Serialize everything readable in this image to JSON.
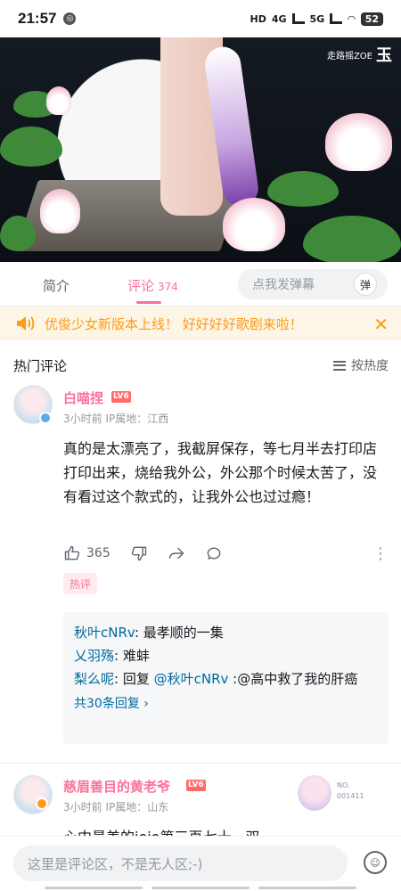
{
  "status_bar": {
    "time": "21:57",
    "network": "4G",
    "network2": "5G",
    "battery": "52"
  },
  "video": {
    "watermark_small": "走路摇ZOE",
    "watermark_logo": "玉"
  },
  "tabs": {
    "intro": "简介",
    "comments": "评论",
    "comment_count": "374"
  },
  "danmaku": {
    "placeholder": "点我发弹幕",
    "button": "弹"
  },
  "notice": {
    "text": "优俊少女新版本上线！ 好好好好歌剧来啦！",
    "close": "✕"
  },
  "hot": {
    "title": "热门评论",
    "sort_label": "按热度"
  },
  "comments": [
    {
      "username": "白喵捏",
      "level": "LV6",
      "meta": "3小时前  IP属地：江西",
      "text": "真的是太漂亮了，我截屏保存，等七月半去打印店打印出来，烧给我外公，外公那个时候太苦了，没有看过这个款式的，让我外公也过过瘾！",
      "likes": "365",
      "tag": "热评",
      "replies": [
        {
          "user": "秋叶cNRv",
          "text": ": 最孝顺的一集"
        },
        {
          "user": "乂羽殇",
          "text": ": 难蚌"
        },
        {
          "user": "梨么呢",
          "text": ": 回复 ",
          "at": "@秋叶cNRv",
          "text2": " :@高中救了我的肝癌"
        }
      ],
      "reply_total": "共30条回复 ›"
    },
    {
      "username": "慈眉善目的黄老爷",
      "level": "LV6",
      "meta": "3小时前  IP属地：山东",
      "fan_no_label": "NO.",
      "fan_no": "001411",
      "text": "心中最美的jojo第三页七十一双"
    }
  ],
  "bottom": {
    "placeholder": "这里是评论区，不是无人区;-)"
  },
  "colors": {
    "accent": "#fb7299",
    "link": "#00699d",
    "notice": "#ff9a16"
  }
}
